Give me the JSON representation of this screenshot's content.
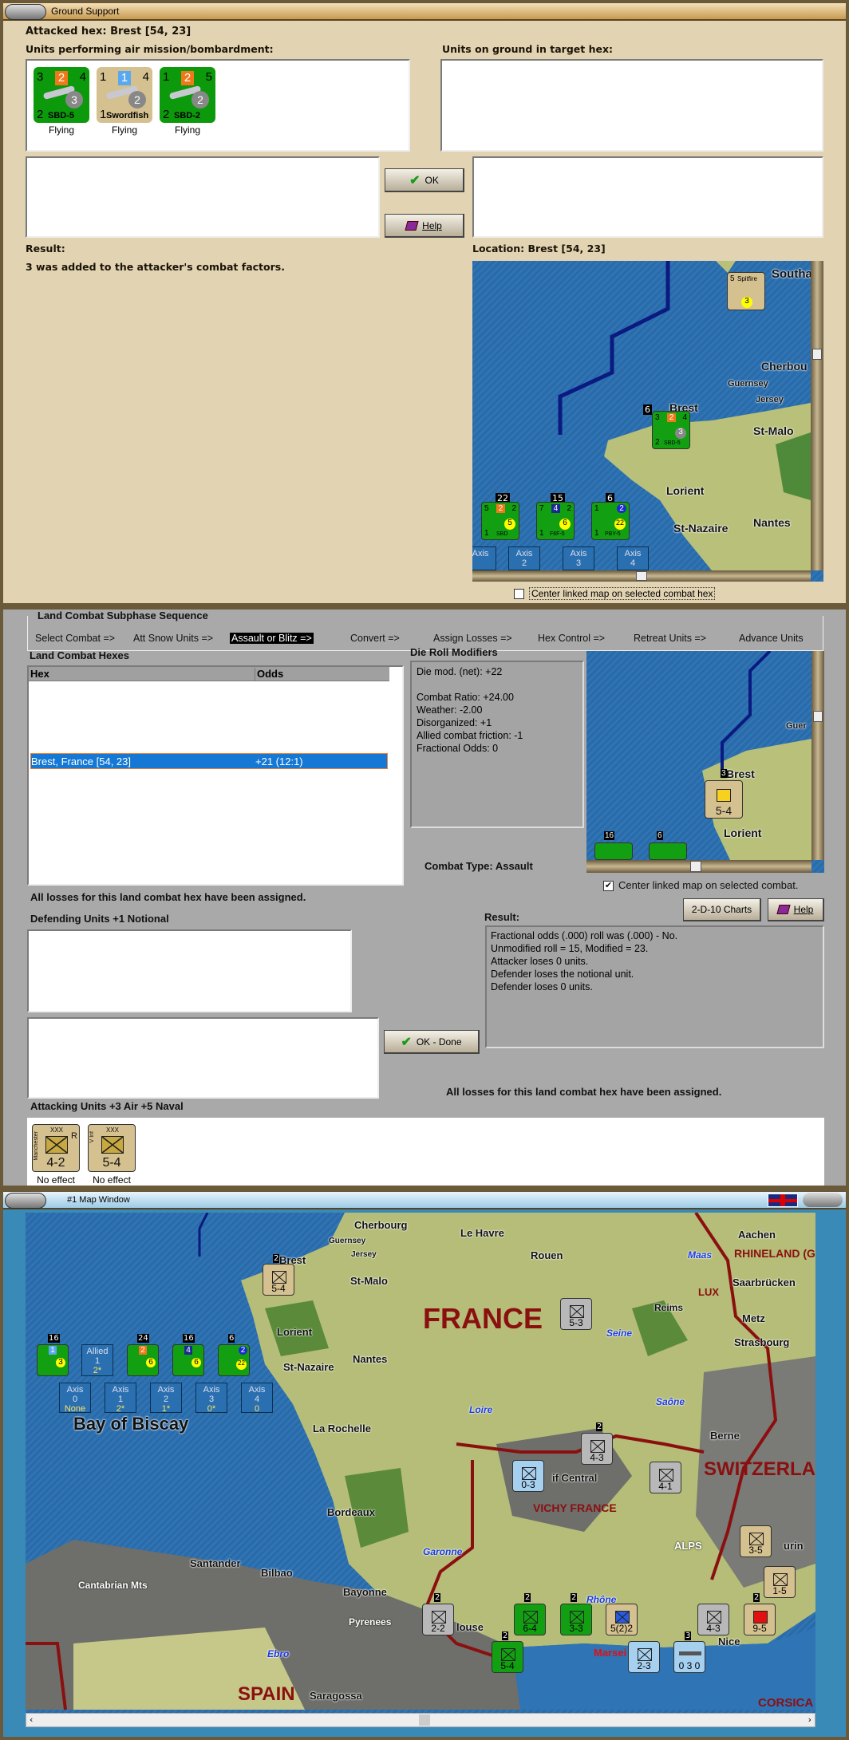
{
  "ground_support": {
    "title": "Ground Support",
    "attacked_hex": "Attacked hex: Brest  [54, 23]",
    "air_units_label": "Units performing air mission/bombardment:",
    "ground_units_label": "Units on ground in target hex:",
    "air_units": [
      {
        "tl": "3",
        "tc": "2",
        "tr": "4",
        "circle": "3",
        "bl": "2",
        "name": "SBD-5",
        "status": "Flying"
      },
      {
        "tl": "1",
        "tc": "1",
        "tr": "4",
        "circle": "2",
        "bl": "1",
        "name": "Swordfish",
        "status": "Flying"
      },
      {
        "tl": "1",
        "tc": "2",
        "tr": "5",
        "circle": "2",
        "bl": "2",
        "name": "SBD-2",
        "status": "Flying"
      }
    ],
    "ok_label": "OK",
    "help_label": "Help",
    "result_label": "Result:",
    "result_text": "3 was added to the attacker's combat factors.",
    "location": "Location:  Brest  [54, 23]",
    "center_checkbox": "Center linked map on selected combat hex",
    "center_checked": false,
    "map": {
      "places": [
        "Southa",
        "Cherbou",
        "Guernsey",
        "Jersey",
        "Brest",
        "St-Malo",
        "Lorient",
        "St-Nazaire",
        "Nantes"
      ],
      "spitfire": {
        "top": "5",
        "name": "Spitfire",
        "circle": "3"
      },
      "brest_stack": {
        "count": "6",
        "tl": "3",
        "tc": "2",
        "tr": "4",
        "circle": "3",
        "bl": "2",
        "name": "SBD-5"
      },
      "stacks": [
        {
          "count": "22",
          "tl": "5",
          "tc": "2",
          "tr": "2",
          "circle": "5",
          "bl": "1",
          "name": "SBD"
        },
        {
          "count": "15",
          "tl": "7",
          "tc": "4",
          "tr": "2",
          "circle": "6",
          "bl": "1",
          "name": "F6F-5"
        },
        {
          "count": "6",
          "tl": "1",
          "tc": "2",
          "tr": "",
          "circle": "22",
          "bl": "1",
          "name": "PBY-5"
        }
      ],
      "tabs": [
        {
          "l1": "Axis",
          "l2": ""
        },
        {
          "l1": "Axis",
          "l2": "2"
        },
        {
          "l1": "Axis",
          "l2": "3"
        },
        {
          "l1": "Axis",
          "l2": "4"
        }
      ]
    }
  },
  "land_combat": {
    "title": "Land Combat Subphase Sequence",
    "sequence": [
      "Select Combat =>",
      "Att Snow Units =>",
      "Assault or Blitz =>",
      "Convert =>",
      "Assign Losses =>",
      "Hex Control =>",
      "Retreat Units =>",
      "Advance Units"
    ],
    "active_step": "Assault or Blitz =>",
    "hexes_label": "Land Combat Hexes",
    "columns": [
      "Hex",
      "Odds"
    ],
    "rows": [
      {
        "hex": "Brest, France [54, 23]",
        "odds": "+21 (12:1)",
        "selected": true
      }
    ],
    "drm_label": "Die Roll Modifiers",
    "drm": [
      "Die mod. (net): +22",
      "",
      "Combat Ratio: +24.00",
      "Weather: -2.00",
      "Disorganized: +1",
      "Allied combat friction: -1",
      "Fractional Odds: 0"
    ],
    "combat_type": "Combat Type:  Assault",
    "center_checkbox": "Center linked map on selected combat.",
    "center_checked": true,
    "losses_msg": "All losses for this land combat hex have been assigned.",
    "charts_btn": "2-D-10 Charts",
    "help_btn": "Help",
    "defending_label": "Defending Units +1 Notional",
    "result_label": "Result:",
    "result_lines": [
      "Fractional odds (.000) roll was (.000)  - No.",
      "Unmodified roll = 15, Modified = 23.",
      "Attacker loses 0 units.",
      "Defender loses the notional unit.",
      "Defender loses 0 units."
    ],
    "ok_done": "OK - Done",
    "attacking_label": "Attacking Units +3 Air +5 Naval",
    "attackers": [
      {
        "name": "Manchester",
        "size": "XXX",
        "flag": "R",
        "type": "M",
        "value": "4-2",
        "status": "No effect"
      },
      {
        "name": "V Inf",
        "size": "XXX",
        "flag": "",
        "type": "",
        "value": "5-4",
        "status": "No effect"
      }
    ],
    "minimap": {
      "places": [
        "Brest",
        "Guer",
        "Lorient"
      ],
      "stack_count": "3",
      "unit_value": "5-4",
      "bottom_counts": [
        "16",
        "6"
      ]
    }
  },
  "map_window": {
    "title": "#1 Map Window",
    "places": {
      "cherbourg": "Cherbourg",
      "guernsey": "Guernsey",
      "jersey": "Jersey",
      "le_havre": "Le Havre",
      "rouen": "Rouen",
      "brest": "Brest",
      "st_malo": "St-Malo",
      "france": "FRANCE",
      "lorient": "Lorient",
      "nantes": "Nantes",
      "st_nazaire": "St-Nazaire",
      "seine": "Seine",
      "reims": "Reims",
      "metz": "Metz",
      "strasbourg": "Strasbourg",
      "aachen": "Aachen",
      "rhineland": "RHINELAND (G",
      "maas": "Maas",
      "saarbrucken": "Saarbrücken",
      "lux": "LUX",
      "saone": "Saône",
      "loire": "Loire",
      "la_rochelle": "La Rochelle",
      "biscay": "Bay of Biscay",
      "berne": "Berne",
      "switzerland": "SWITZERLA",
      "massif": "if Central",
      "vichy": "VICHY FRANCE",
      "bordeaux": "Bordeaux",
      "garonne": "Garonne",
      "alps": "ALPS",
      "santander": "Santander",
      "bilbao": "Bilbao",
      "cantabrian": "Cantabrian Mts",
      "bayonne": "Bayonne",
      "pyrenees": "Pyrenees",
      "toulouse": "louse",
      "rhone": "Rhône",
      "nice": "Nice",
      "marseille": "Marsei",
      "ebro": "Ebro",
      "spain": "SPAIN",
      "saragossa": "Saragossa",
      "corsica": "CORSICA",
      "turin": "urin"
    },
    "air_stack": [
      {
        "count": "16",
        "tc": "1",
        "circle": "3"
      },
      {
        "allied": "Allied",
        "n": "1",
        "s": "2*"
      },
      {
        "count": "24",
        "tc": "2",
        "circle": "6"
      },
      {
        "count": "16",
        "tc": "4",
        "circle": "6"
      },
      {
        "count": "6",
        "tc": "2",
        "circle": "22"
      }
    ],
    "axis_tabs": [
      {
        "l": "Axis",
        "n": "0",
        "s": "None"
      },
      {
        "l": "Axis",
        "n": "1",
        "s": "2*"
      },
      {
        "l": "Axis",
        "n": "2",
        "s": "1*"
      },
      {
        "l": "Axis",
        "n": "3",
        "s": "0*"
      },
      {
        "l": "Axis",
        "n": "4",
        "s": "0"
      }
    ],
    "units": [
      {
        "value": "5-4",
        "count": "2"
      },
      {
        "value": "5-3"
      },
      {
        "value": "4-3",
        "count": "2"
      },
      {
        "value": "0-3"
      },
      {
        "value": "4-1"
      },
      {
        "value": "3-5"
      },
      {
        "value": "1-5"
      },
      {
        "value": "2-2",
        "count": "2"
      },
      {
        "value": "6-4",
        "count": "2"
      },
      {
        "value": "3-3",
        "count": "2"
      },
      {
        "value": "5(2)2"
      },
      {
        "value": "4-3"
      },
      {
        "value": "9-5",
        "count": "2"
      },
      {
        "value": "5-4",
        "count": "2"
      },
      {
        "value": "2-3"
      },
      {
        "value": "0 3 0",
        "count": "3"
      }
    ]
  }
}
